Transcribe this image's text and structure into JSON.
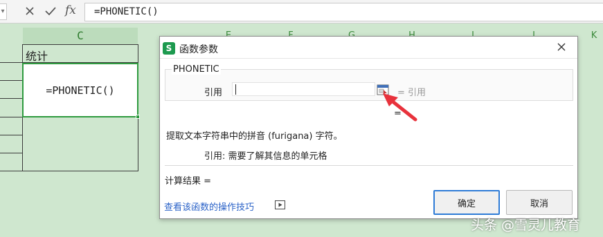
{
  "formula_bar": {
    "dropdown_icon": "chevron-down-icon",
    "cancel_icon": "close-x-icon",
    "confirm_icon": "check-icon",
    "fx_label": "fx",
    "formula": "=PHONETIC()"
  },
  "grid": {
    "column_headers": [
      "C",
      "E",
      "F",
      "G",
      "H",
      "I",
      "J",
      "K"
    ],
    "cells": {
      "header_text": "统计",
      "active_formula": "=PHONETIC()"
    },
    "colors": {
      "background": "#cfe7cf",
      "active_border": "#2e9a3e"
    }
  },
  "dialog": {
    "title": "函数参数",
    "logo_letter": "S",
    "logo_color": "#1d9a4f",
    "function_name": "PHONETIC",
    "arguments": [
      {
        "label": "引用",
        "value": "",
        "evaluated": "= 引用"
      }
    ],
    "function_result_eq": "=",
    "description": "提取文本字符串中的拼音 (furigana) 字符。",
    "argument_description": "引用:  需要了解其信息的单元格",
    "calc_result_label": "计算结果 =",
    "help_link": "查看该函数的操作技巧",
    "ok_label": "确定",
    "cancel_label": "取消",
    "accent_color": "#2d7bd6"
  },
  "annotation": {
    "arrow_color": "#e8323c"
  },
  "watermark": "头条 @雪灵儿教育"
}
